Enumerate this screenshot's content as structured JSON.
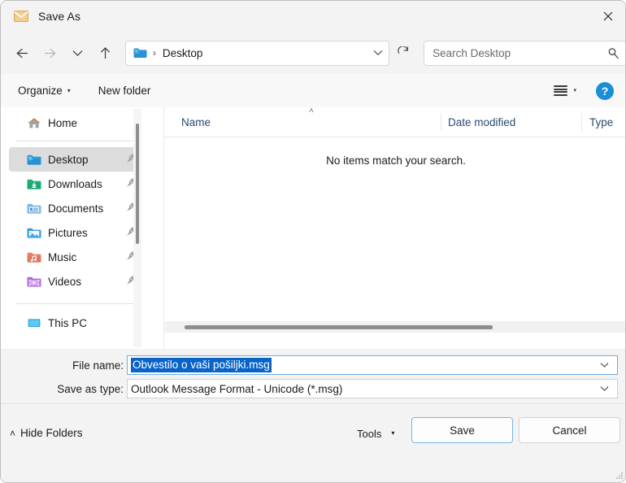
{
  "window": {
    "title": "Save As",
    "title_icon": "mail-envelope-icon",
    "close_label": "✕"
  },
  "nav": {
    "back_icon": "arrow-left-icon",
    "forward_icon": "arrow-right-icon",
    "recent_icon": "chevron-down-icon",
    "up_icon": "arrow-up-icon",
    "address": {
      "folder_icon": "folder-icon",
      "separator": "›",
      "crumb": "Desktop",
      "dropdown_icon": "chevron-down-icon",
      "refresh_icon": "refresh-icon"
    },
    "search": {
      "placeholder": "Search Desktop",
      "icon": "search-icon"
    }
  },
  "toolbar": {
    "organize_label": "Organize",
    "organize_caret": "▾",
    "new_folder_label": "New folder",
    "view_icon": "list-view-icon",
    "view_caret": "▾",
    "help_label": "?"
  },
  "sidebar": {
    "home": {
      "label": "Home",
      "icon": "home-icon"
    },
    "items": [
      {
        "label": "Desktop",
        "icon": "folder-desktop-icon",
        "pinned": true,
        "selected": true
      },
      {
        "label": "Downloads",
        "icon": "folder-downloads-icon",
        "pinned": true,
        "selected": false
      },
      {
        "label": "Documents",
        "icon": "folder-documents-icon",
        "pinned": true,
        "selected": false
      },
      {
        "label": "Pictures",
        "icon": "folder-pictures-icon",
        "pinned": true,
        "selected": false
      },
      {
        "label": "Music",
        "icon": "folder-music-icon",
        "pinned": true,
        "selected": false
      },
      {
        "label": "Videos",
        "icon": "folder-videos-icon",
        "pinned": true,
        "selected": false
      }
    ],
    "this_pc": {
      "label": "This PC",
      "icon": "computer-icon"
    }
  },
  "filelist": {
    "columns": [
      "Name",
      "Date modified",
      "Type"
    ],
    "sort_indicator": "˄",
    "empty_message": "No items match your search."
  },
  "form": {
    "file_name_label": "File name:",
    "file_name_value": "Obvestilo o vaši pošiljki.msg",
    "save_as_type_label": "Save as type:",
    "save_as_type_value": "Outlook Message Format - Unicode (*.msg)",
    "dropdown_icon": "chevron-down-icon"
  },
  "footer": {
    "hide_folders_caret": "˄",
    "hide_folders_label": "Hide Folders",
    "tools_label": "Tools",
    "tools_caret": "▾",
    "save_label": "Save",
    "cancel_label": "Cancel"
  },
  "colors": {
    "selection_blue": "#0a64c8",
    "focus_border": "#6daee0",
    "help_blue": "#1a8fd8",
    "column_header_text": "#2b4a6f",
    "title_icon_tan": "#e8b96a"
  }
}
